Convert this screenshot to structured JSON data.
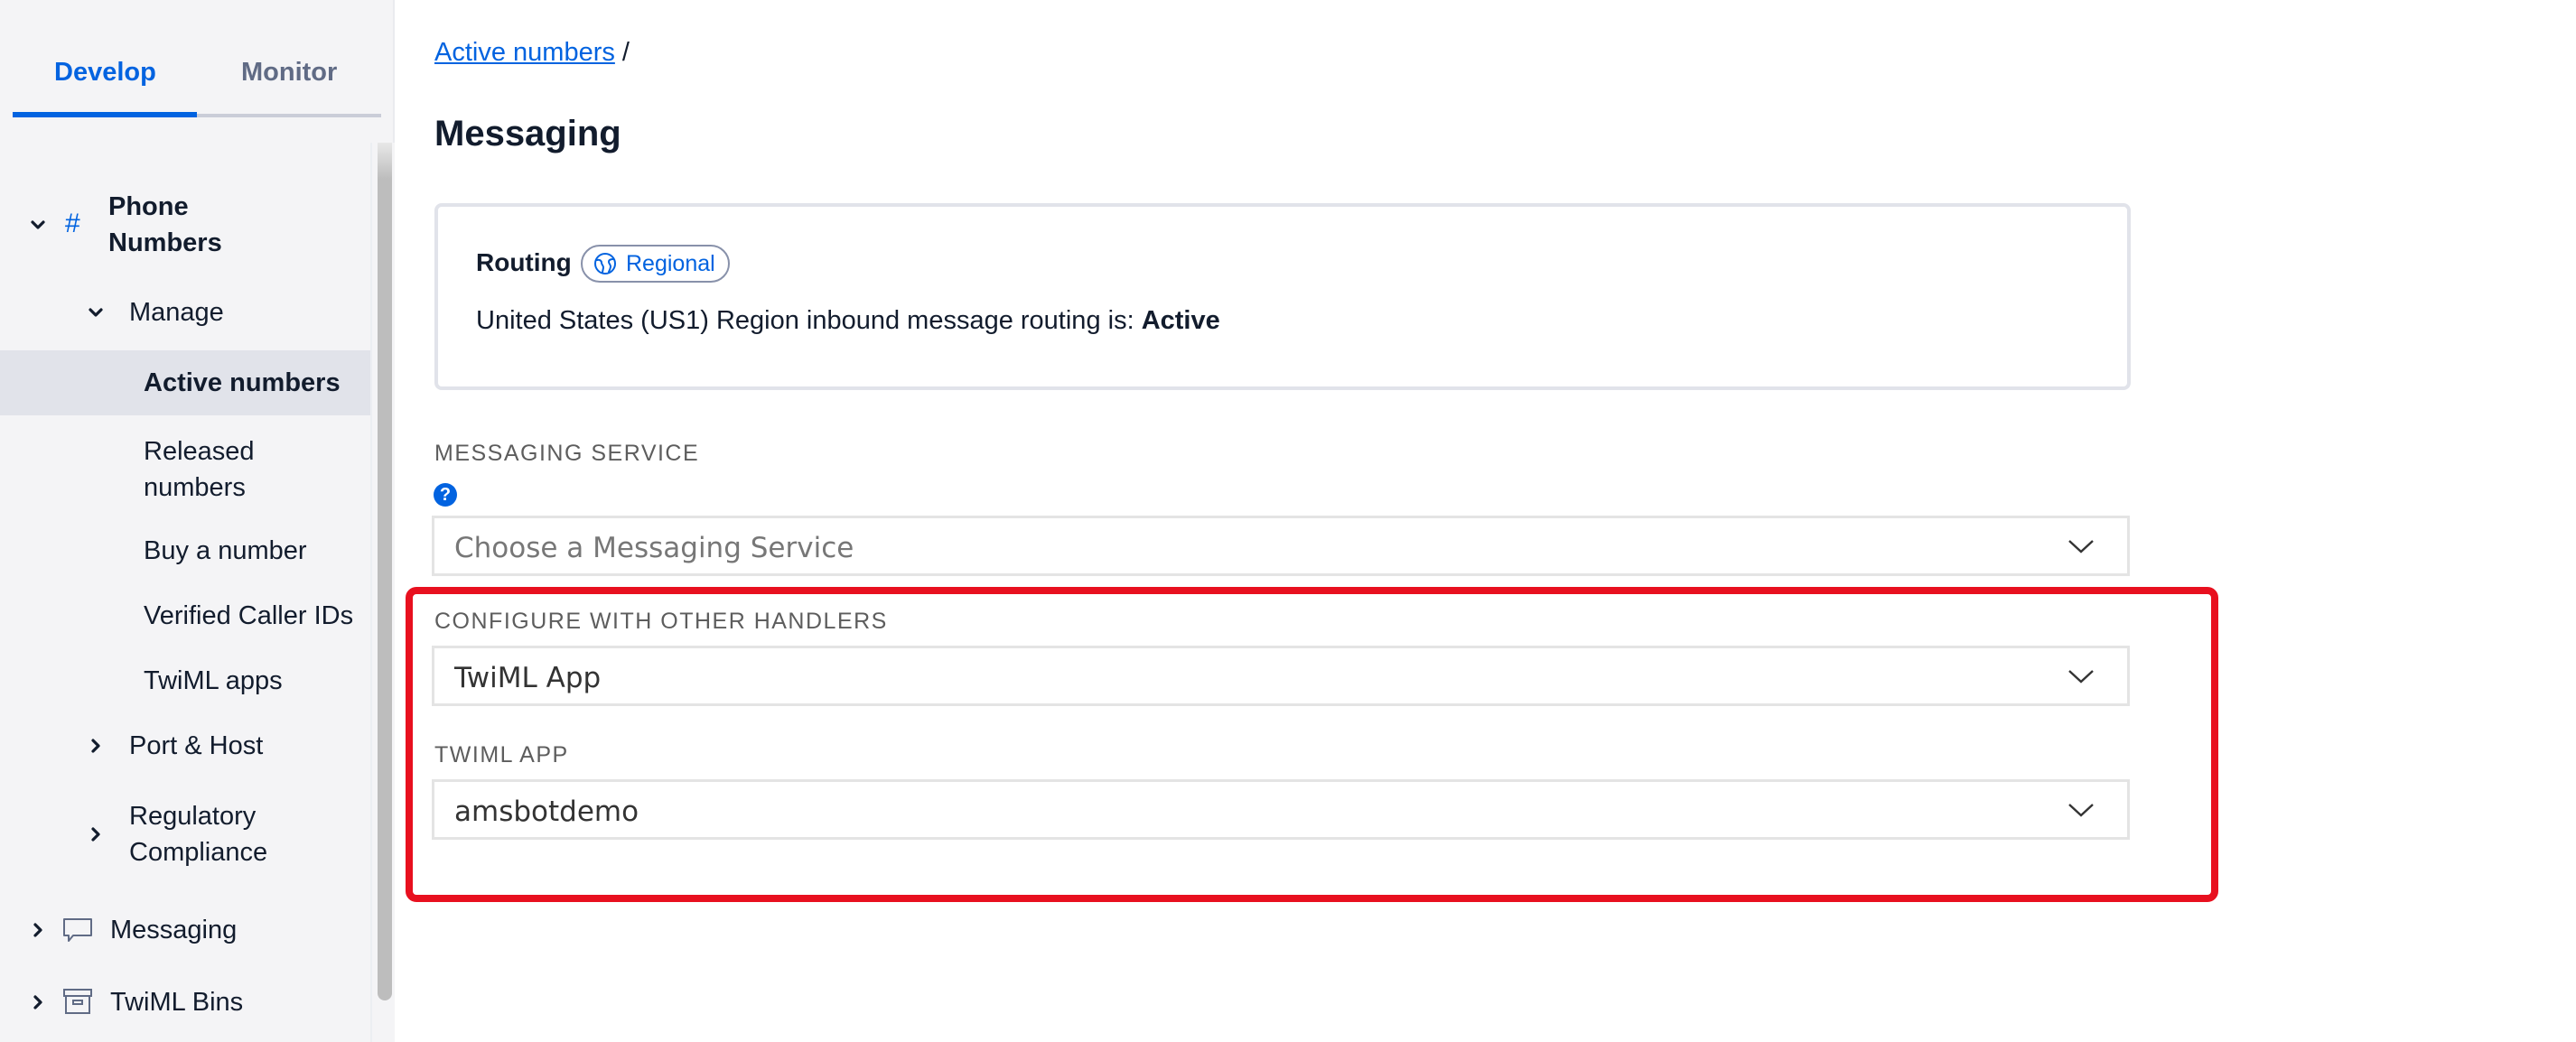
{
  "sidebar": {
    "tabs": [
      {
        "label": "Develop",
        "active": true
      },
      {
        "label": "Monitor",
        "active": false
      }
    ],
    "nav": {
      "phone_numbers": {
        "label_line1": "Phone",
        "label_line2": "Numbers",
        "icon": "hash-icon",
        "expanded": true
      },
      "manage": {
        "label": "Manage",
        "expanded": true
      },
      "active_numbers": {
        "label": "Active numbers",
        "selected": true
      },
      "released_numbers": {
        "label_line1": "Released",
        "label_line2": "numbers"
      },
      "buy_a_number": {
        "label": "Buy a number"
      },
      "verified_caller_ids": {
        "label": "Verified Caller IDs"
      },
      "twiml_apps": {
        "label": "TwiML apps"
      },
      "port_host": {
        "label": "Port & Host",
        "expanded": false
      },
      "regulatory_compliance": {
        "label_line1": "Regulatory",
        "label_line2": "Compliance",
        "expanded": false
      },
      "messaging": {
        "label": "Messaging",
        "icon": "chat-bubble-icon",
        "expanded": false
      },
      "twiml_bins": {
        "label": "TwiML Bins",
        "icon": "archive-box-icon",
        "expanded": false
      }
    }
  },
  "breadcrumb": {
    "link": "Active numbers",
    "separator": "/"
  },
  "page": {
    "title": "Messaging"
  },
  "routing": {
    "title": "Routing",
    "badge": "Regional",
    "body_prefix": "United States (US1) Region inbound message routing is: ",
    "status": "Active"
  },
  "messaging_service": {
    "label": "MESSAGING SERVICE",
    "help": "?",
    "placeholder": "Choose a Messaging Service"
  },
  "other_handlers": {
    "label": "CONFIGURE WITH OTHER HANDLERS",
    "value": "TwiML App"
  },
  "twiml_app": {
    "label": "TWIML APP",
    "value": "amsbotdemo"
  },
  "colors": {
    "accent": "#0263e0",
    "highlight": "#e8101f",
    "sidebar_bg": "#f4f4f6",
    "selected_bg": "#e1e3ea"
  }
}
